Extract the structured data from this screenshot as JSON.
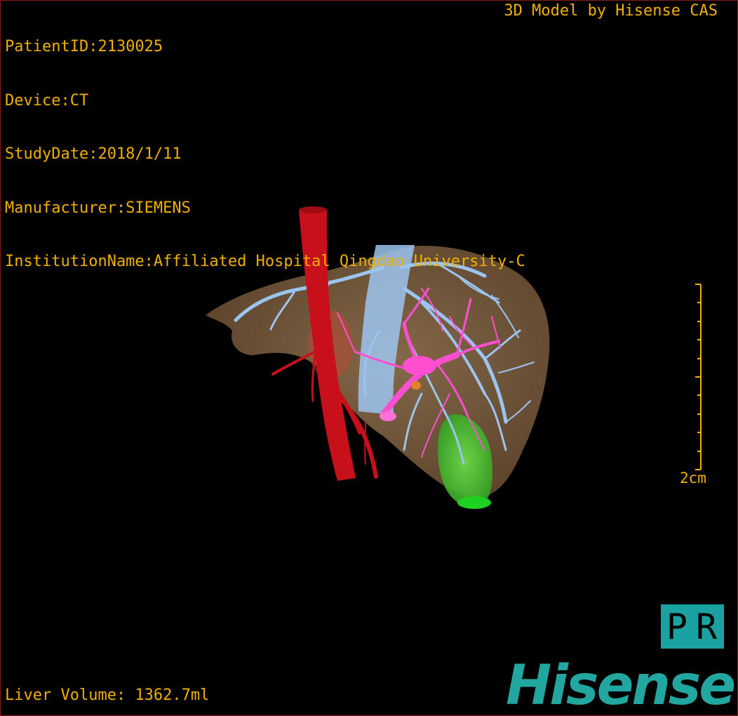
{
  "header": {
    "patient_id": "PatientID:2130025",
    "device": "Device:CT",
    "study_date": "StudyDate:2018/1/11",
    "manufacturer": "Manufacturer:SIEMENS",
    "institution": "InstitutionName:Affiliated Hospital Qingdao University-C"
  },
  "credit": "3D Model by Hisense CAS",
  "scale": {
    "label": "2cm"
  },
  "volume": "Liver Volume: 1362.7ml",
  "orientation_badge": {
    "left": "P",
    "right": "R"
  },
  "logo": "Hisense",
  "colors": {
    "overlay_text": "#f0b000",
    "liver": "#8a6a48",
    "artery": "#c8101a",
    "portal_vein": "#ff4fd0",
    "hepatic_vein": "#9cc4f0",
    "gallbladder": "#4fd030",
    "badge": "#1aa2a2",
    "logo": "#22a7a0"
  }
}
